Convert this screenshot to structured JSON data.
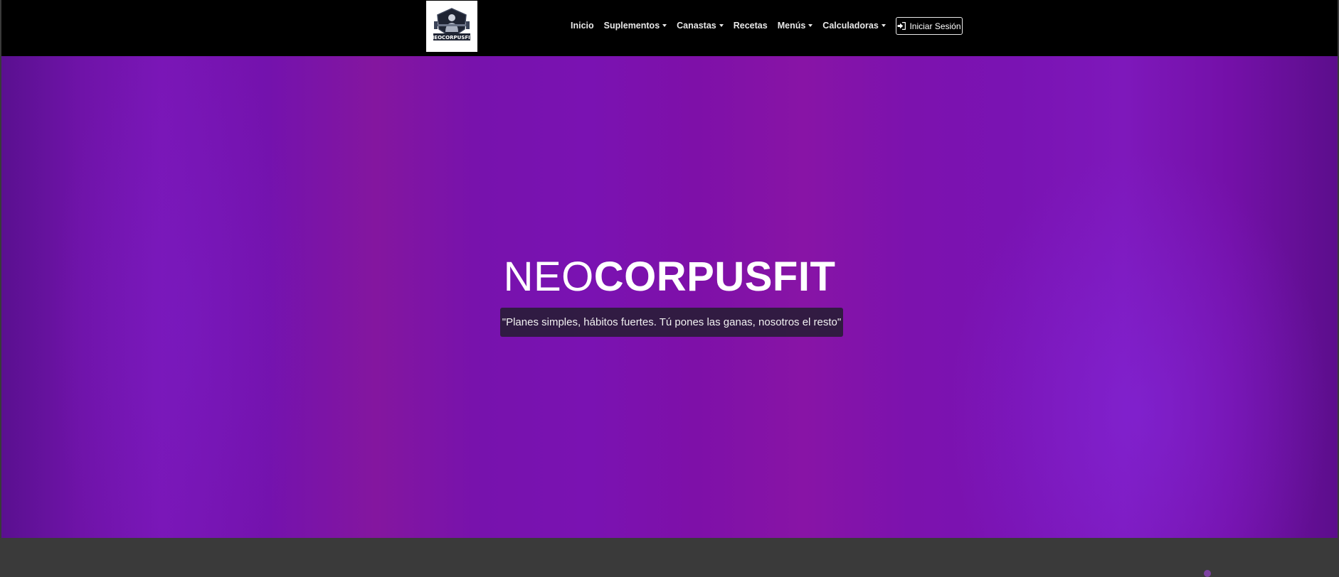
{
  "navbar": {
    "logo_text": "NEOCORPUSFIT",
    "links": [
      {
        "label": "Inicio",
        "dropdown": false
      },
      {
        "label": "Suplementos",
        "dropdown": true
      },
      {
        "label": "Canastas",
        "dropdown": true
      },
      {
        "label": "Recetas",
        "dropdown": false
      },
      {
        "label": "Menús",
        "dropdown": true
      },
      {
        "label": "Calculadoras",
        "dropdown": true
      }
    ],
    "login_label": "Iniciar Sesión",
    "login_icon": "sign-in-icon"
  },
  "hero": {
    "title_light": "NEO",
    "title_bold": "CORPUSFIT",
    "tagline": "\"Planes simples, hábitos fuertes. Tú pones las ganas, nosotros el resto\""
  },
  "colors": {
    "nav_bg": "#000000",
    "hero_purple": "#7a13b0",
    "tagline_bg": "#2a1c3a"
  }
}
